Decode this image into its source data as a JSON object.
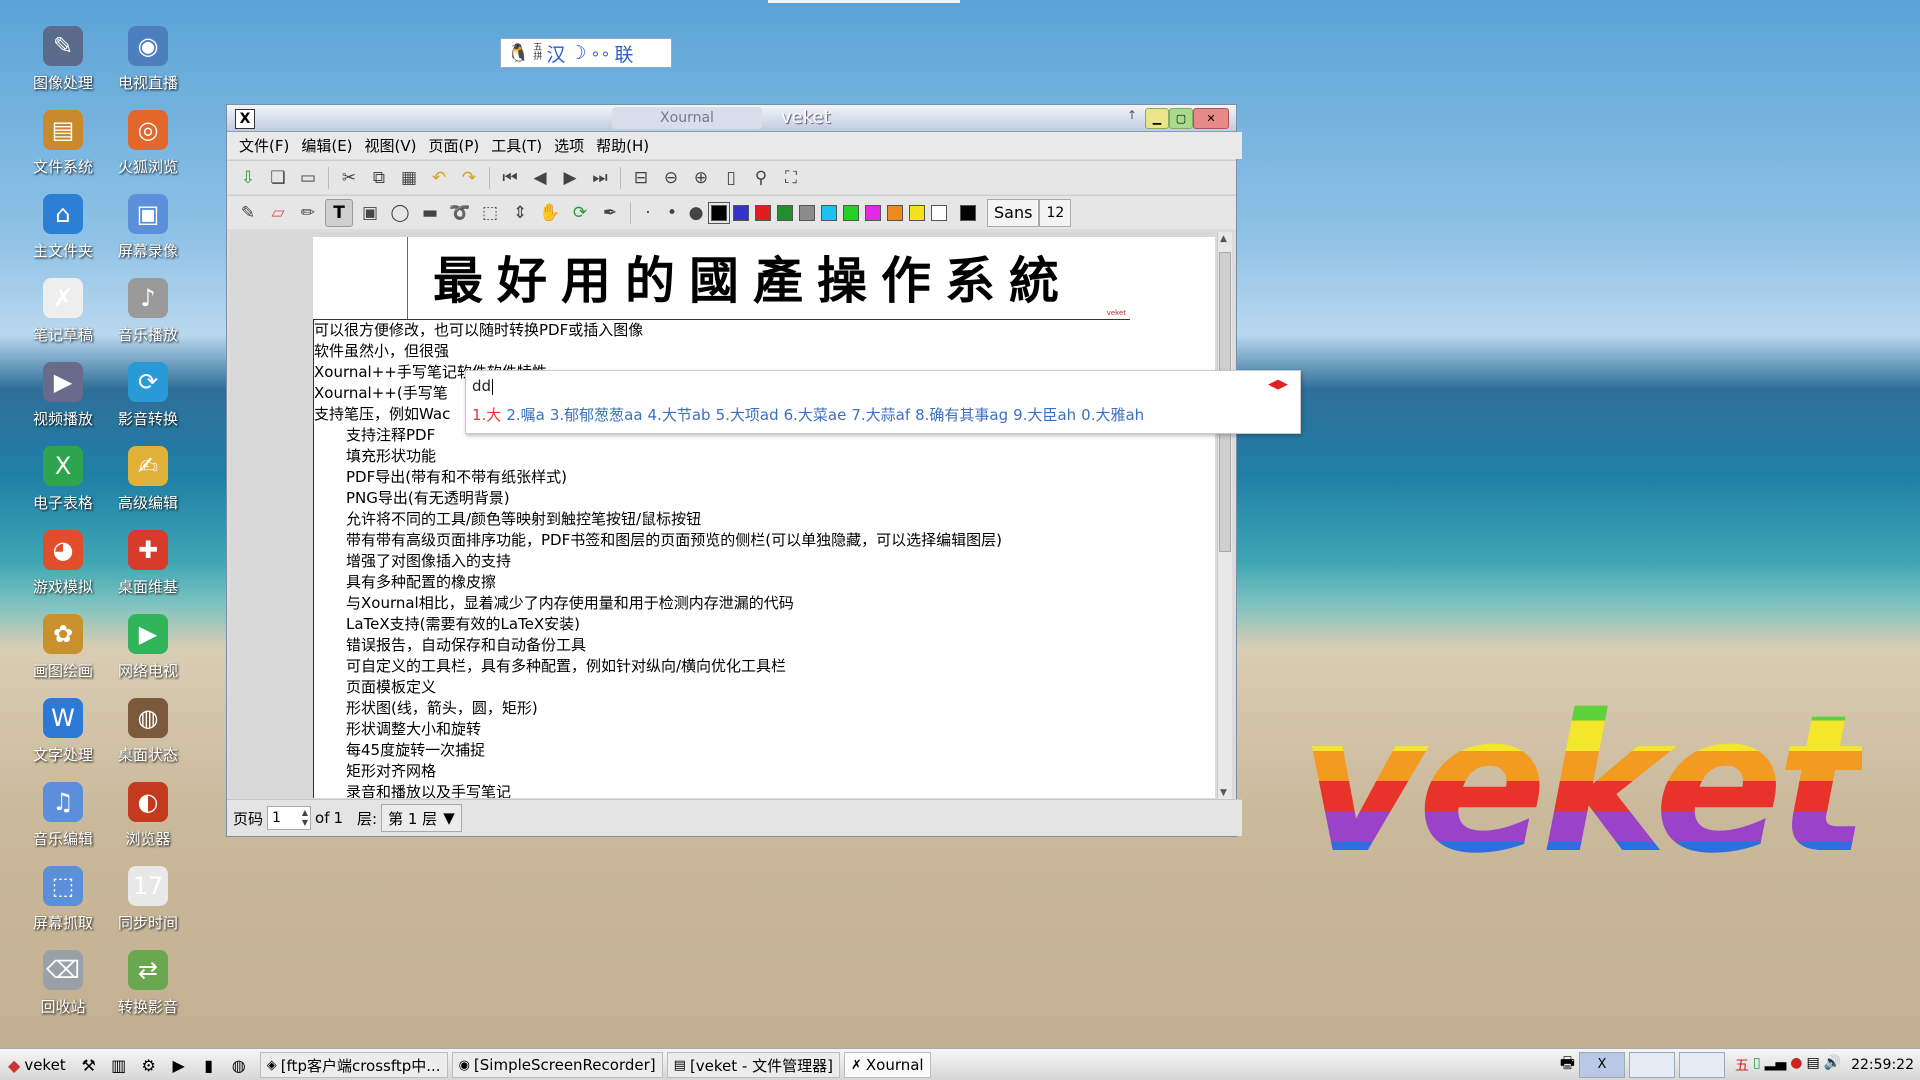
{
  "ime_bar": {
    "text": "拼 汉 ☽ ∘ 联",
    "mode_icon": "penguin-icon",
    "mode_label": "五\n拼",
    "lang_label": "汉",
    "moon_label": "☽",
    "dots_label": "∘∘",
    "link_label": "联"
  },
  "desktop_icons": [
    {
      "label": "图像处理",
      "icon": "image-editor-icon",
      "color": "#5a6b8c"
    },
    {
      "label": "电视直播",
      "icon": "tv-icon",
      "color": "#4d7fbf"
    },
    {
      "label": "文件系统",
      "icon": "folder-icon",
      "color": "#c98a2e"
    },
    {
      "label": "火狐浏览",
      "icon": "firefox-icon",
      "color": "#e3662b"
    },
    {
      "label": "主文件夹",
      "icon": "home-folder-icon",
      "color": "#2d7fd6"
    },
    {
      "label": "屏幕录像",
      "icon": "screen-record-icon",
      "color": "#5b8fd9"
    },
    {
      "label": "笔记草稿",
      "icon": "xournal-icon",
      "color": "#eeeeee"
    },
    {
      "label": "音乐播放",
      "icon": "speaker-icon",
      "color": "#9a9a9a"
    },
    {
      "label": "视频播放",
      "icon": "video-player-icon",
      "color": "#6a6a8a"
    },
    {
      "label": "影音转换",
      "icon": "media-convert-icon",
      "color": "#2a9ad6"
    },
    {
      "label": "电子表格",
      "icon": "spreadsheet-icon",
      "color": "#2ea44f"
    },
    {
      "label": "高级编辑",
      "icon": "text-editor-icon",
      "color": "#e0b23a"
    },
    {
      "label": "游戏模拟",
      "icon": "game-icon",
      "color": "#e04e2b"
    },
    {
      "label": "桌面维基",
      "icon": "wiki-icon",
      "color": "#d63b2b"
    },
    {
      "label": "画图绘画",
      "icon": "paint-icon",
      "color": "#c9902e"
    },
    {
      "label": "网络电视",
      "icon": "play-icon",
      "color": "#2fb45a"
    },
    {
      "label": "文字处理",
      "icon": "writer-icon",
      "color": "#2e78d6"
    },
    {
      "label": "桌面状态",
      "icon": "monitor-status-icon",
      "color": "#7a5a3a"
    },
    {
      "label": "音乐编辑",
      "icon": "audio-editor-icon",
      "color": "#5b8fd9"
    },
    {
      "label": "浏览器",
      "icon": "browser-icon",
      "color": "#c33a1f"
    },
    {
      "label": "屏幕抓取",
      "icon": "screenshot-icon",
      "color": "#5b8fd9"
    },
    {
      "label": "同步时间",
      "icon": "calendar-icon",
      "color": "#e8e8e8"
    },
    {
      "label": "回收站",
      "icon": "trash-icon",
      "color": "#9aa0a8"
    },
    {
      "label": "转换影音",
      "icon": "convert-video-icon",
      "color": "#6aa84f"
    }
  ],
  "window": {
    "inactive_tab": "Xournal",
    "title": "veket",
    "menu": [
      "文件(F)",
      "编辑(E)",
      "视图(V)",
      "页面(P)",
      "工具(T)",
      "选项",
      "帮助(H)"
    ],
    "toolbar1": [
      "save-icon",
      "new-icon",
      "open-icon",
      "cut-icon",
      "copy-icon",
      "paste-icon",
      "undo-icon",
      "redo-icon",
      "first-page-icon",
      "prev-page-icon",
      "next-page-icon",
      "last-page-icon",
      "zoom-fit-icon",
      "zoom-out-icon",
      "zoom-in-icon",
      "page-width-icon",
      "search-icon",
      "fullscreen-icon"
    ],
    "toolbar2_tools": [
      "pen-icon",
      "eraser-icon",
      "highlighter-icon",
      "text-icon",
      "image-icon",
      "shape-icon",
      "ruler-icon",
      "lasso-icon",
      "rect-select-icon",
      "vertical-space-icon",
      "hand-icon",
      "refresh-icon",
      "color-pick-icon"
    ],
    "dot_sizes": [
      "·",
      "•",
      "●"
    ],
    "colors": [
      "#000000",
      "#3333cc",
      "#e11d1d",
      "#1f8f2f",
      "#8c8c8c",
      "#19c3ef",
      "#22d122",
      "#e12ae1",
      "#ef8a1a",
      "#f2e11b",
      "#ffffff",
      "#000000"
    ],
    "font": "Sans",
    "font_size": "12",
    "banner_text": "最好用的國產操作系統",
    "banner_mark": "veket",
    "doc_lines": [
      "可以很方便修改，也可以随时转换PDF或插入图像",
      "软件虽然小，但很强",
      "Xournal++手写笔记软件软件特性",
      "Xournal++(手写笔",
      "支持笔压，例如Wac"
    ],
    "doc_features": [
      "支持注释PDF",
      "填充形状功能",
      "PDF导出(带有和不带有纸张样式)",
      "PNG导出(有无透明背景)",
      "允许将不同的工具/颜色等映射到触控笔按钮/鼠标按钮",
      "带有带有高级页面排序功能，PDF书签和图层的页面预览的侧栏(可以单独隐藏，可以选择编辑图层)",
      "增强了对图像插入的支持",
      "具有多种配置的橡皮擦",
      "与Xournal相比，显着减少了内存使用量和用于检测内存泄漏的代码",
      "LaTeX支持(需要有效的LaTeX安装)",
      "错误报告，自动保存和自动备份工具",
      "可自定义的工具栏，具有多种配置，例如针对纵向/横向优化工具栏",
      "页面模板定义",
      "形状图(线，箭头，圆，矩形)",
      "形状调整大小和旋转",
      "每45度旋转一次捕捉",
      "矩形对齐网格",
      "录音和播放以及手写笔记"
    ],
    "status": {
      "page_label": "页码",
      "page_value": "1",
      "of_label": "of",
      "total_pages": "1",
      "layer_label": "层:",
      "layer_value": "第 1 层"
    }
  },
  "ime_popup": {
    "composition": "dd",
    "paging": "◀▶",
    "candidates": [
      "1.大",
      "2.嘱a",
      "3.郁郁葱葱aa",
      "4.大节ab",
      "5.大项ad",
      "6.大菜ae",
      "7.大蒜af",
      "8.确有其事ag",
      "9.大臣ah",
      "0.大雅ah"
    ]
  },
  "wallpaper_logo": "veket",
  "taskbar": {
    "start_label": "veket",
    "quick_icons": [
      "tools-icon",
      "system-monitor-icon",
      "network-icon",
      "play-icon",
      "terminal-icon",
      "globe-icon"
    ],
    "tasks": [
      {
        "label": "[ftp客户端crossftp中...",
        "icon": "ftp-icon",
        "active": false
      },
      {
        "label": "[SimpleScreenRecorder]",
        "icon": "recorder-icon",
        "active": false
      },
      {
        "label": "[veket - 文件管理器]",
        "icon": "file-manager-icon",
        "active": false
      },
      {
        "label": "Xournal",
        "icon": "xournal-icon",
        "active": true
      }
    ],
    "tray_icons": [
      "ime-wubi-icon",
      "battery-icon",
      "signal-icon",
      "record-icon",
      "clipboard-icon",
      "volume-icon"
    ],
    "clock": "22:59:22"
  }
}
